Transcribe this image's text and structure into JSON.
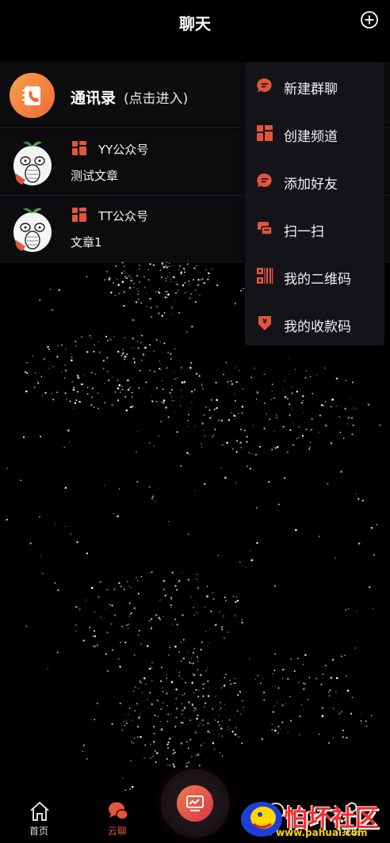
{
  "header": {
    "title": "聊天",
    "plus_icon": "plus-circle-icon"
  },
  "contacts": {
    "label": "通讯录",
    "hint": "(点击进入)",
    "icon": "address-book-icon"
  },
  "chats": [
    {
      "name": "YY公众号",
      "preview": "测试文章",
      "avatar": "meme-avatar",
      "badge_icon": "official-account-icon"
    },
    {
      "name": "TT公众号",
      "preview": "文章1",
      "avatar": "meme-avatar",
      "badge_icon": "official-account-icon"
    }
  ],
  "menu": {
    "items": [
      {
        "label": "新建群聊",
        "icon": "chat-bubble-icon"
      },
      {
        "label": "创建频道",
        "icon": "grid-icon"
      },
      {
        "label": "添加好友",
        "icon": "chat-bubble-icon"
      },
      {
        "label": "扫一扫",
        "icon": "scan-icon"
      },
      {
        "label": "我的二维码",
        "icon": "qrcode-icon"
      },
      {
        "label": "我的收款码",
        "icon": "yen-icon"
      }
    ]
  },
  "tabbar": {
    "tabs": [
      {
        "label": "首页",
        "icon": "home-icon",
        "active": false
      },
      {
        "label": "云聊",
        "icon": "chat-bubbles-icon",
        "active": true
      },
      {
        "label": "产",
        "icon": "asset-icon",
        "active": false
      },
      {
        "label": "我的",
        "icon": "person-icon",
        "active": false
      }
    ],
    "center_icon": "monitor-chart-icon"
  },
  "watermark": {
    "text": "怕坏社区",
    "url": "www.pahuai.com"
  },
  "colors": {
    "accent": "#e3553c",
    "background": "#000000",
    "row_background": "#0d0d10",
    "menu_background": "#141418"
  }
}
